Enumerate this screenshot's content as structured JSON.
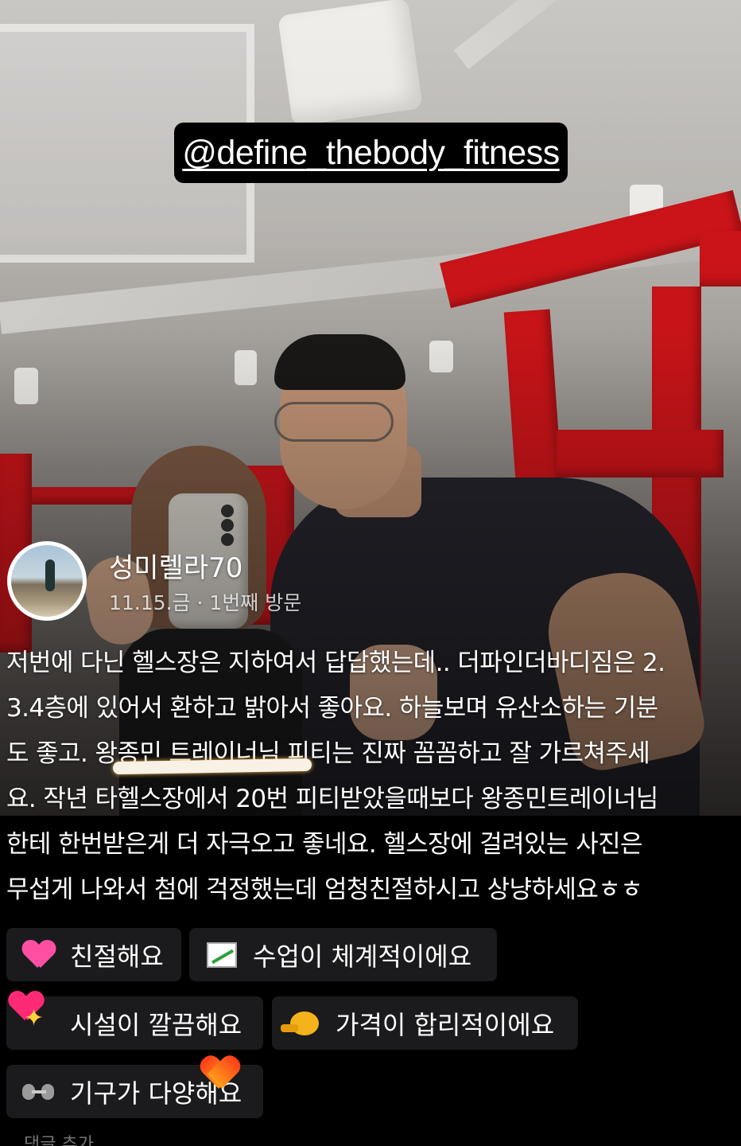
{
  "story": {
    "mention": "@define_thebody_fitness"
  },
  "review": {
    "author": "성미렐라70",
    "meta": "11.15.금 · 1번째 방문",
    "lines": [
      "저번에 다닌 헬스장은 지하여서 답답했는데.. 더파인더바디짐은 2.",
      "3.4층에 있어서 환하고 밝아서 좋아요. 하늘보며 유산소하는 기분",
      "도 좋고. 왕종민 트레이너님 피티는 진짜 꼼꼼하고 잘 가르쳐주세",
      "요. 작년 타헬스장에서 20번 피티받았을때보다 왕종민트레이너님",
      "한테 한번받은게 더 자극오고 좋네요. 헬스장에 걸려있는 사진은",
      "무섭게 나와서 첨에 걱정했는데 엄청친절하시고 상냥하세요ㅎㅎ"
    ]
  },
  "keywords": [
    {
      "icon": "heart-icon",
      "label": "친절해요"
    },
    {
      "icon": "chart-increasing-icon",
      "label": "수업이 체계적이에요"
    },
    {
      "icon": "sparkles-icon",
      "label": "시설이 깔끔해요"
    },
    {
      "icon": "coin-icon",
      "label": "가격이 합리적이에요"
    },
    {
      "icon": "dumbbell-icon",
      "label": "기구가 다양해요"
    }
  ],
  "footer": {
    "comment_hint": "댓글 추가"
  },
  "colors": {
    "chip_bg": "#1b1b1d",
    "mention_bg": "#000000",
    "highlight": "#f8f1e6",
    "heart_pink": "#ff2a76",
    "heart_orange": "#ff6a1a"
  }
}
